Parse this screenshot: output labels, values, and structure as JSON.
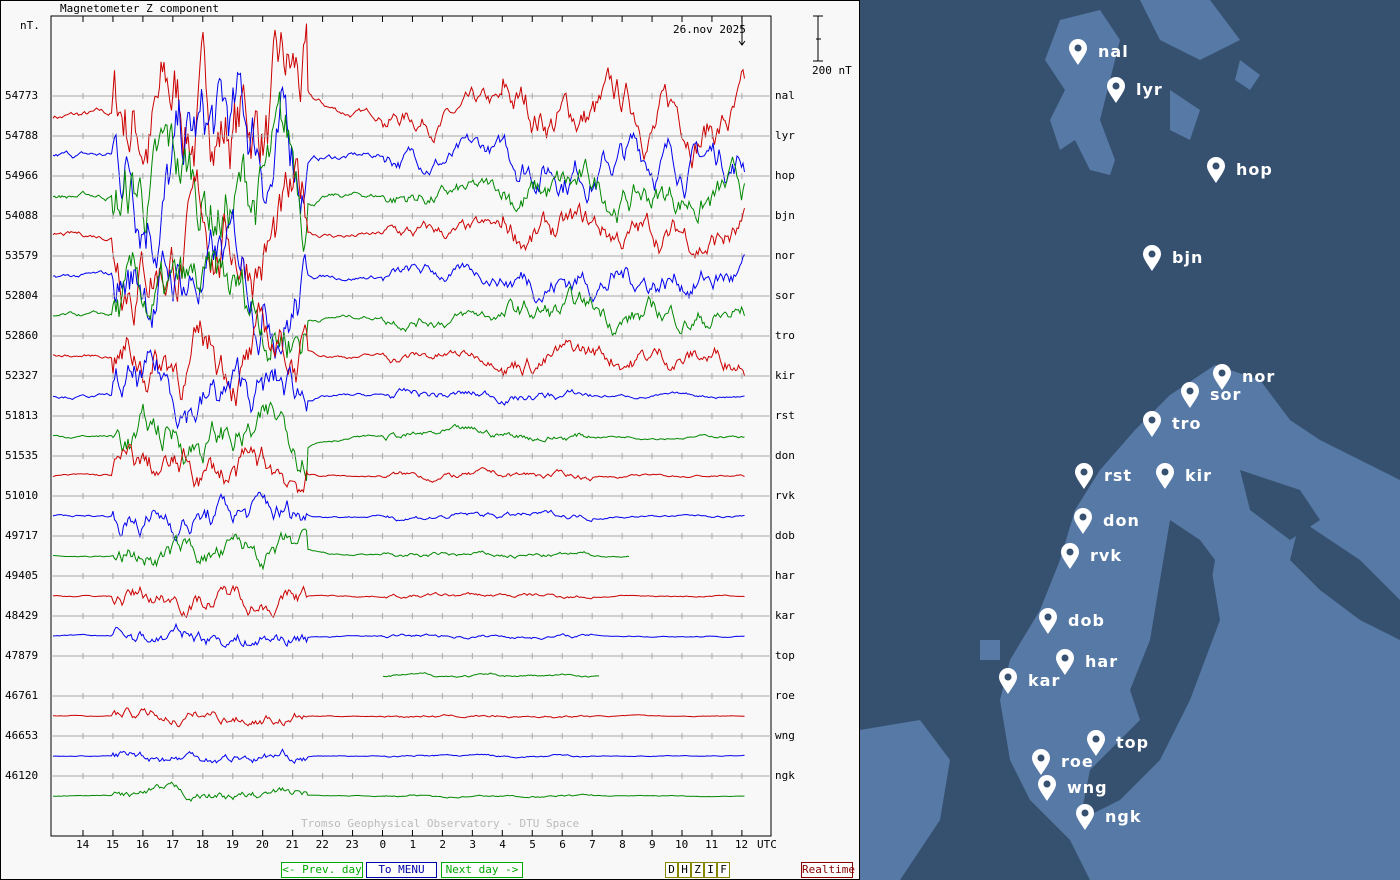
{
  "title": "Magnetometer Z component",
  "unit_label": "nT.",
  "date": "26.nov 2025",
  "scale_label": "200 nT",
  "watermark": "Tromso Geophysical Observatory - DTU Space",
  "utc_label": "UTC",
  "buttons": {
    "prev": "<- Prev. day",
    "menu": "To MENU",
    "next": "Next day ->",
    "realtime": "Realtime",
    "components": [
      "D",
      "H",
      "Z",
      "I",
      "F"
    ]
  },
  "colors": {
    "red": "#cc0000",
    "blue": "#0000ee",
    "green": "#008800",
    "sea": "#36506f",
    "land": "#5679a6"
  },
  "chart_data": {
    "type": "line",
    "title": "Magnetometer Z component",
    "ylabel": "nT.",
    "xlabel": "UTC",
    "x_ticks": [
      "14",
      "15",
      "16",
      "17",
      "18",
      "19",
      "20",
      "21",
      "22",
      "23",
      "0",
      "1",
      "2",
      "3",
      "4",
      "5",
      "6",
      "7",
      "8",
      "9",
      "10",
      "11",
      "12"
    ],
    "x_range_hours": [
      13,
      36.1
    ],
    "scale_bar_nT": 200,
    "series": [
      {
        "name": "nal",
        "baseline": 54773,
        "color": "red"
      },
      {
        "name": "lyr",
        "baseline": 54788,
        "color": "blue"
      },
      {
        "name": "hop",
        "baseline": 54966,
        "color": "green"
      },
      {
        "name": "bjn",
        "baseline": 54088,
        "color": "red"
      },
      {
        "name": "nor",
        "baseline": 53579,
        "color": "blue"
      },
      {
        "name": "sor",
        "baseline": 52804,
        "color": "green"
      },
      {
        "name": "tro",
        "baseline": 52860,
        "color": "red"
      },
      {
        "name": "kir",
        "baseline": 52327,
        "color": "blue"
      },
      {
        "name": "rst",
        "baseline": 51813,
        "color": "green"
      },
      {
        "name": "don",
        "baseline": 51535,
        "color": "red"
      },
      {
        "name": "rvk",
        "baseline": 51010,
        "color": "blue"
      },
      {
        "name": "dob",
        "baseline": 49717,
        "color": "green"
      },
      {
        "name": "har",
        "baseline": 49405,
        "color": "red"
      },
      {
        "name": "kar",
        "baseline": 48429,
        "color": "blue"
      },
      {
        "name": "top",
        "baseline": 47879,
        "color": "green"
      },
      {
        "name": "roe",
        "baseline": 46761,
        "color": "red"
      },
      {
        "name": "wng",
        "baseline": 46653,
        "color": "blue"
      },
      {
        "name": "ngk",
        "baseline": 46120,
        "color": "green"
      }
    ]
  },
  "map_stations": [
    "nal",
    "lyr",
    "hop",
    "bjn",
    "nor",
    "sor",
    "tro",
    "rst",
    "kir",
    "don",
    "rvk",
    "dob",
    "har",
    "kar",
    "top",
    "roe",
    "wng",
    "ngk"
  ]
}
